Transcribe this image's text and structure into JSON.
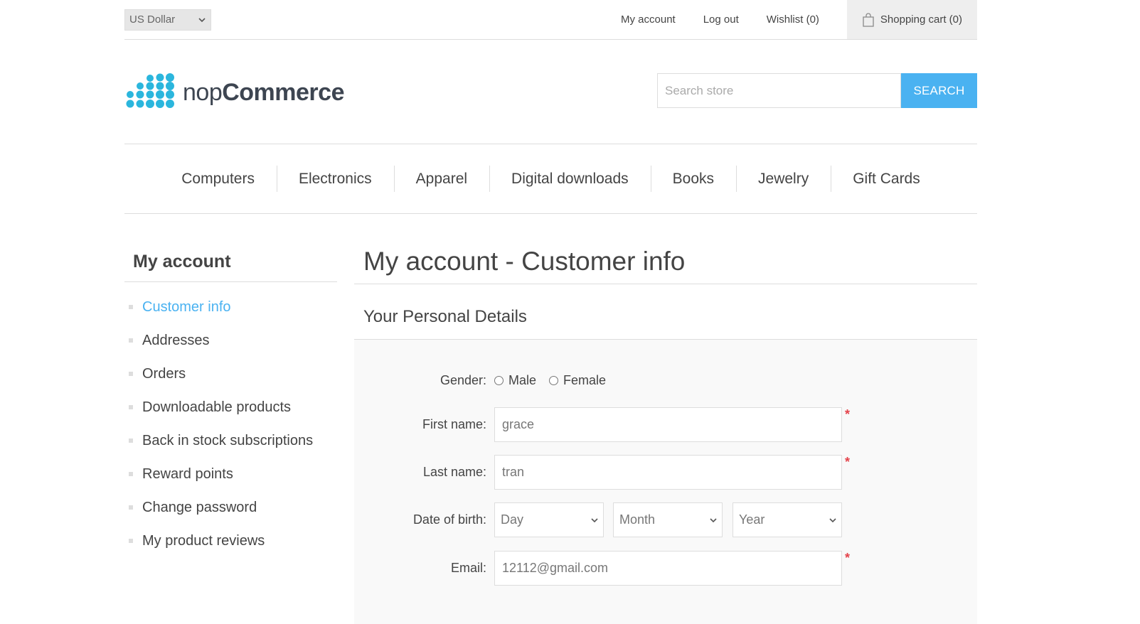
{
  "header": {
    "currency": "US Dollar",
    "links": [
      "My account",
      "Log out",
      "Wishlist (0)"
    ],
    "cart": "Shopping cart (0)"
  },
  "logo": {
    "part1": "nop",
    "part2": "Commerce"
  },
  "search": {
    "placeholder": "Search store",
    "button": "Search"
  },
  "menu": [
    "Computers",
    "Electronics",
    "Apparel",
    "Digital downloads",
    "Books",
    "Jewelry",
    "Gift Cards"
  ],
  "side": {
    "title": "My account",
    "items": [
      "Customer info",
      "Addresses",
      "Orders",
      "Downloadable products",
      "Back in stock subscriptions",
      "Reward points",
      "Change password",
      "My product reviews"
    ]
  },
  "main": {
    "title": "My account - Customer info",
    "section": "Your Personal Details",
    "form": {
      "gender_label": "Gender:",
      "male": "Male",
      "female": "Female",
      "first_name_label": "First name:",
      "first_name_value": "grace",
      "last_name_label": "Last name:",
      "last_name_value": "tran",
      "dob_label": "Date of birth:",
      "day": "Day",
      "month": "Month",
      "year": "Year",
      "email_label": "Email:",
      "email_value": "12112@gmail.com",
      "required_mark": "*"
    }
  },
  "colors": {
    "accent": "#4ab2f1",
    "required": "#e4434b"
  }
}
